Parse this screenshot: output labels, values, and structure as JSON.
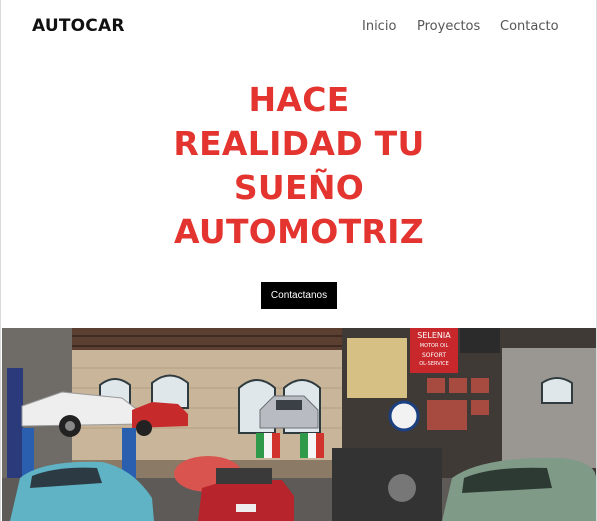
{
  "header": {
    "logo": "AUTOCAR",
    "nav": [
      "Inicio",
      "Proyectos",
      "Contacto"
    ]
  },
  "hero": {
    "lines": [
      "HACE",
      "REALIDAD TU",
      "SUEÑO",
      "AUTOMOTRIZ"
    ],
    "cta_label": "Contactanos"
  },
  "photo": {
    "sign_text": [
      "SELENIA",
      "MOTOR OIL",
      "SOFORT",
      "OL-SERVICE"
    ]
  },
  "colors": {
    "accent": "#e3342f",
    "button_bg": "#000000",
    "text": "#111111"
  }
}
